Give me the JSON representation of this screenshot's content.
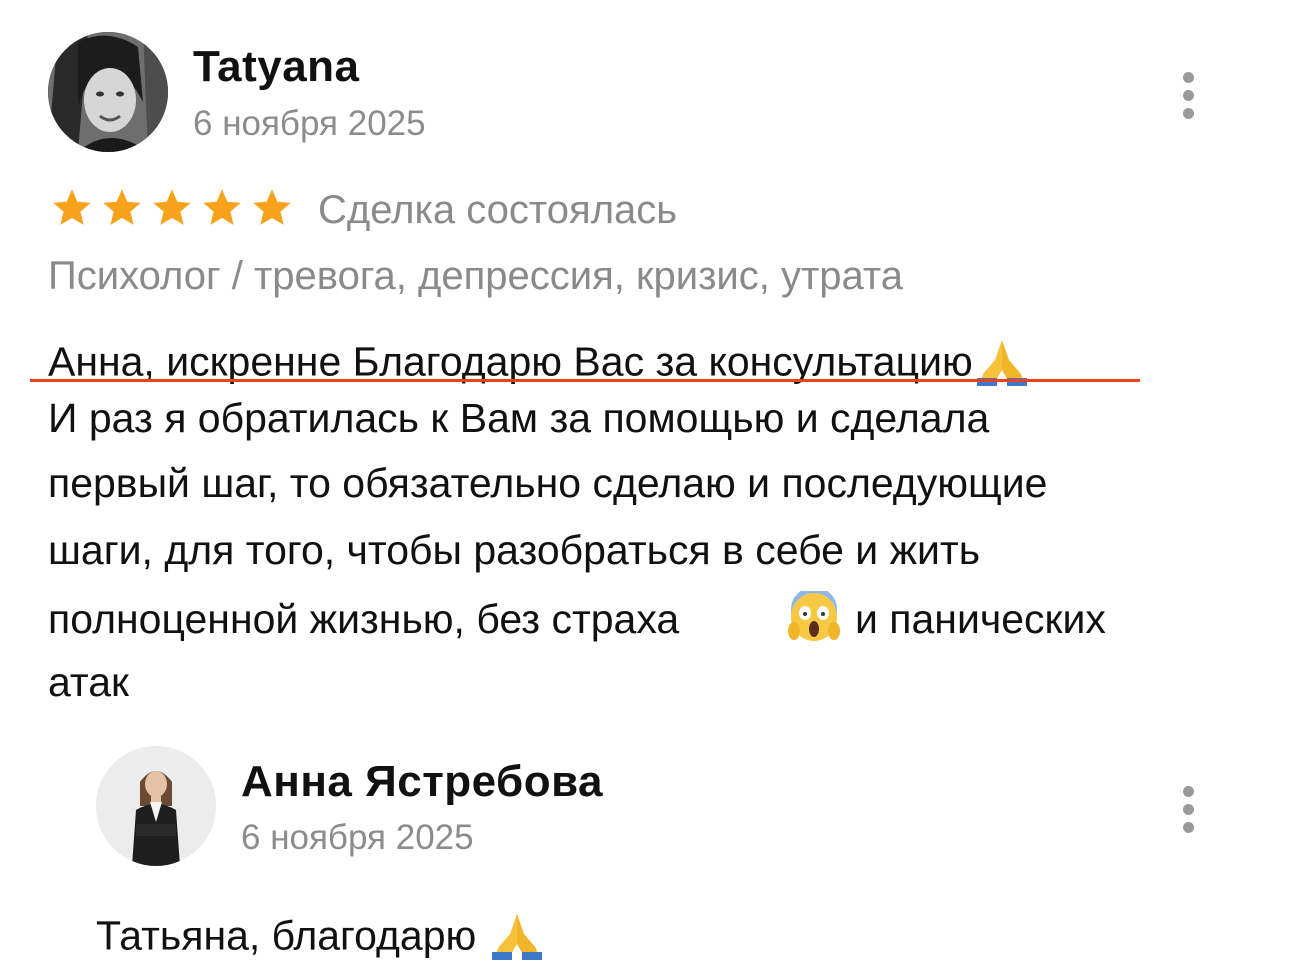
{
  "review": {
    "author": "Tatyana",
    "date": "6 ноября 2025",
    "rating": 5,
    "rating_max": 5,
    "deal_status": "Сделка состоялась",
    "category": "Психолог / тревога, депрессия, кризис, утрата",
    "lines": [
      "Анна, искренне Благодарю Вас за консультацию",
      "И раз я обратилась к Вам за помощью и сделала",
      "первый шаг, то обязательно сделаю и последующие",
      "шаги, для того,  чтобы разобраться в себе и жить",
      "полноценной жизнью, без страха",
      "и панических",
      "атак"
    ]
  },
  "reply": {
    "author": "Анна Ястребова",
    "date": "6 ноября 2025",
    "text": "Татьяна, благодарю"
  },
  "colors": {
    "star": "#f7a21b",
    "muted_text": "#8a8a8a",
    "underline": "#e8431f"
  },
  "icons": {
    "menu": "more-vertical-icon",
    "pray": "folded-hands-emoji",
    "scream": "face-screaming-in-fear-emoji"
  }
}
